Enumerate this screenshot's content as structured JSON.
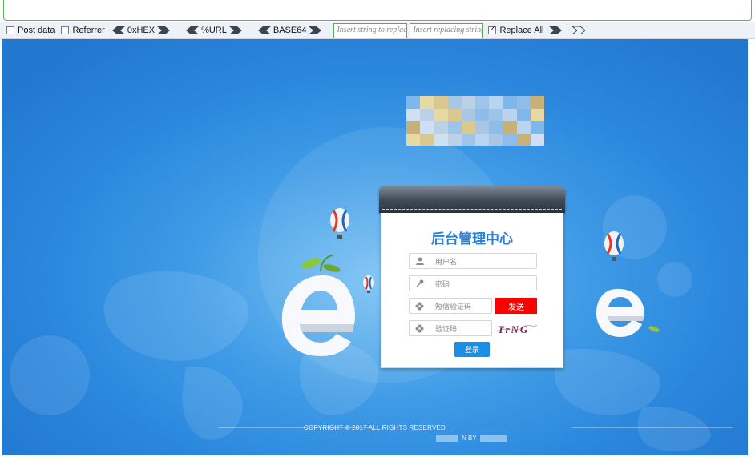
{
  "toolbar": {
    "post_data_label": "Post data",
    "referrer_label": "Referrer",
    "hex_label": "0xHEX",
    "url_label": "%URL",
    "base64_label": "BASE64",
    "replace_string_placeholder": "Insert string to replace",
    "replacing_string_placeholder": "Insert replacing string",
    "replace_all_label": "Replace All",
    "post_data_checked": false,
    "referrer_checked": false,
    "replace_all_checked": true
  },
  "login": {
    "title": "后台管理中心",
    "username_placeholder": "用户名",
    "password_placeholder": "密码",
    "sms_code_placeholder": "短信验证码",
    "send_button": "发送",
    "captcha_placeholder": "验证码",
    "captcha_text": "TrNG",
    "login_button": "登录"
  },
  "footer": {
    "copyright": "COPYRIGHT © 2017 ALL RIGHTS RESERVED",
    "powered_by_fragment": "N BY"
  },
  "colors": {
    "accent_blue": "#2a7fd6",
    "send_red": "#ff0000",
    "login_blue": "#1a8fe6",
    "toolbar_bg": "#eef2f8",
    "background_blue": "#2a86dc"
  },
  "icons": {
    "username": "user-icon",
    "password": "key-icon",
    "sms_code": "flower-icon",
    "captcha": "flower-icon"
  }
}
